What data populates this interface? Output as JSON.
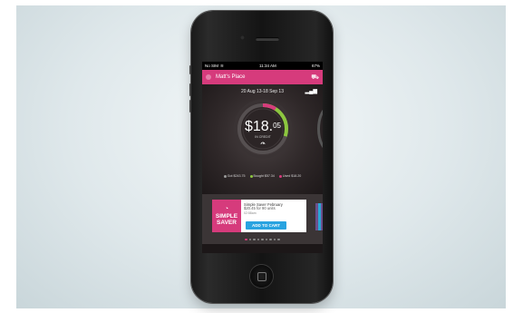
{
  "status_bar": {
    "carrier": "No SIM",
    "wifi_icon": "wifi-icon",
    "time": "11:34 AM",
    "battery": "67%"
  },
  "header": {
    "title": "Matt's Place",
    "menu_icon": "menu-icon",
    "cart_icon": "cart-icon"
  },
  "main": {
    "date_range": "20 Aug 13-18 Sep 13",
    "stats_icon": "bar-chart-icon",
    "amount_main": "$18.",
    "amount_cents": "05",
    "amount_caption": "IN CREDIT",
    "dial_progress": 0.3,
    "legend": [
      {
        "label": "Got $243.75",
        "color": "#9a9a9a"
      },
      {
        "label": "Bought $57.34",
        "color": "#8cc63f"
      },
      {
        "label": "Used $18.20",
        "color": "#d63b7c"
      }
    ]
  },
  "promo": {
    "logo_line1": "SIMPLE",
    "logo_line2": "SAVER",
    "title": "Simple Saver February",
    "subtitle": "$20.45 for 90 units",
    "note": "02:58am",
    "button": "ADD TO CART",
    "pages": 9,
    "active_page": 0
  },
  "colors": {
    "accent": "#d63b7c",
    "green": "#8cc63f",
    "blue": "#29a3e0"
  }
}
